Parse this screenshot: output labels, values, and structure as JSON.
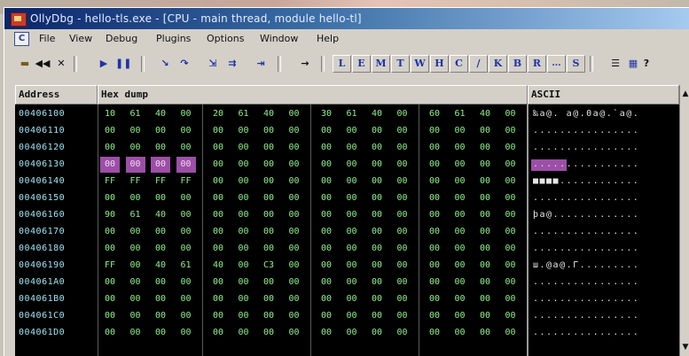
{
  "window": {
    "title": "OllyDbg - hello-tls.exe - [CPU - main thread, module hello-tl]"
  },
  "menu": {
    "items": [
      "File",
      "View",
      "Debug",
      "Plugins",
      "Options",
      "Window",
      "Help"
    ]
  },
  "toolbar": {
    "letter_buttons": [
      "L",
      "E",
      "M",
      "T",
      "W",
      "H",
      "C",
      "/",
      "K",
      "B",
      "R",
      "...",
      "S"
    ],
    "icons": [
      "open-icon",
      "restart-icon",
      "close-icon",
      "run-icon",
      "pause-icon",
      "step-into-icon",
      "step-over-icon",
      "trace-into-icon",
      "trace-over-icon",
      "execute-till-return-icon",
      "goto-icon"
    ]
  },
  "dump": {
    "col_address": "Address",
    "col_hex": "Hex dump",
    "col_ascii": "ASCII",
    "rows": [
      {
        "address": "00406100",
        "bytes": [
          "10",
          "61",
          "40",
          "00",
          "20",
          "61",
          "40",
          "00",
          "30",
          "61",
          "40",
          "00",
          "60",
          "61",
          "40",
          "00"
        ],
        "ascii": "‰a@. a@.0a@.`a@."
      },
      {
        "address": "00406110",
        "bytes": [
          "00",
          "00",
          "00",
          "00",
          "00",
          "00",
          "00",
          "00",
          "00",
          "00",
          "00",
          "00",
          "00",
          "00",
          "00",
          "00"
        ],
        "ascii": "................"
      },
      {
        "address": "00406120",
        "bytes": [
          "00",
          "00",
          "00",
          "00",
          "00",
          "00",
          "00",
          "00",
          "00",
          "00",
          "00",
          "00",
          "00",
          "00",
          "00",
          "00"
        ],
        "ascii": "................"
      },
      {
        "address": "00406130",
        "bytes": [
          "00",
          "00",
          "00",
          "00",
          "00",
          "00",
          "00",
          "00",
          "00",
          "00",
          "00",
          "00",
          "00",
          "00",
          "00",
          "00"
        ],
        "ascii": "................",
        "highlight": 4
      },
      {
        "address": "00406140",
        "bytes": [
          "FF",
          "FF",
          "FF",
          "FF",
          "00",
          "00",
          "00",
          "00",
          "00",
          "00",
          "00",
          "00",
          "00",
          "00",
          "00",
          "00"
        ],
        "ascii": "■■■■............"
      },
      {
        "address": "00406150",
        "bytes": [
          "00",
          "00",
          "00",
          "00",
          "00",
          "00",
          "00",
          "00",
          "00",
          "00",
          "00",
          "00",
          "00",
          "00",
          "00",
          "00"
        ],
        "ascii": "................"
      },
      {
        "address": "00406160",
        "bytes": [
          "90",
          "61",
          "40",
          "00",
          "00",
          "00",
          "00",
          "00",
          "00",
          "00",
          "00",
          "00",
          "00",
          "00",
          "00",
          "00"
        ],
        "ascii": "þa@............."
      },
      {
        "address": "00406170",
        "bytes": [
          "00",
          "00",
          "00",
          "00",
          "00",
          "00",
          "00",
          "00",
          "00",
          "00",
          "00",
          "00",
          "00",
          "00",
          "00",
          "00"
        ],
        "ascii": "................"
      },
      {
        "address": "00406180",
        "bytes": [
          "00",
          "00",
          "00",
          "00",
          "00",
          "00",
          "00",
          "00",
          "00",
          "00",
          "00",
          "00",
          "00",
          "00",
          "00",
          "00"
        ],
        "ascii": "................"
      },
      {
        "address": "00406190",
        "bytes": [
          "FF",
          "00",
          "40",
          "61",
          "40",
          "00",
          "C3",
          "00",
          "00",
          "00",
          "00",
          "00",
          "00",
          "00",
          "00",
          "00"
        ],
        "ascii": "ш.@a@.Г........."
      },
      {
        "address": "004061A0",
        "bytes": [
          "00",
          "00",
          "00",
          "00",
          "00",
          "00",
          "00",
          "00",
          "00",
          "00",
          "00",
          "00",
          "00",
          "00",
          "00",
          "00"
        ],
        "ascii": "................"
      },
      {
        "address": "004061B0",
        "bytes": [
          "00",
          "00",
          "00",
          "00",
          "00",
          "00",
          "00",
          "00",
          "00",
          "00",
          "00",
          "00",
          "00",
          "00",
          "00",
          "00"
        ],
        "ascii": "................"
      },
      {
        "address": "004061C0",
        "bytes": [
          "00",
          "00",
          "00",
          "00",
          "00",
          "00",
          "00",
          "00",
          "00",
          "00",
          "00",
          "00",
          "00",
          "00",
          "00",
          "00"
        ],
        "ascii": "................"
      },
      {
        "address": "004061D0",
        "bytes": [
          "00",
          "00",
          "00",
          "00",
          "00",
          "00",
          "00",
          "00",
          "00",
          "00",
          "00",
          "00",
          "00",
          "00",
          "00",
          "00"
        ],
        "ascii": "................"
      }
    ]
  },
  "colors": {
    "address": "#9fe3f2",
    "hex": "#8ff08b",
    "ascii": "#e6e6e6",
    "selection": "#9c4fa6",
    "background": "#000000"
  }
}
